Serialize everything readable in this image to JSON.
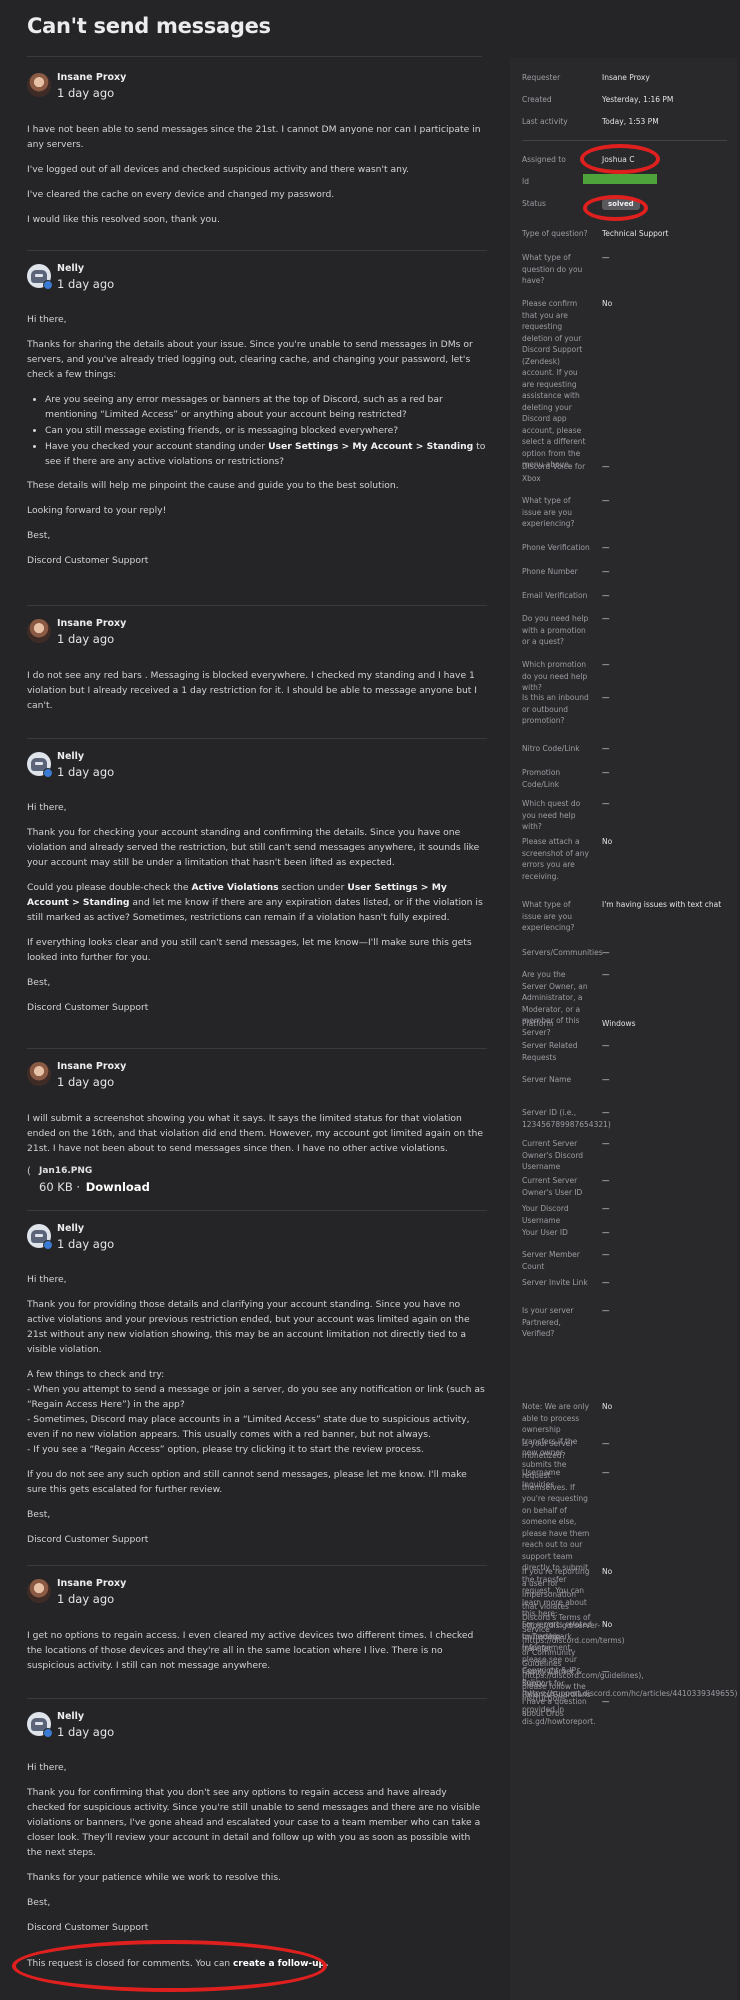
{
  "ticket": {
    "title": "Can't send messages",
    "closed_text": "This request is closed for comments. You can",
    "followup_link": "create a follow-up."
  },
  "messages": [
    {
      "author": "Insane Proxy",
      "time": "1 day ago",
      "paragraphs": [
        "I have not been able to send messages since the 21st. I cannot DM anyone nor can I participate in any servers.",
        "I've logged out of all devices and checked suspicious activity and there wasn't any.",
        "I've cleared the cache on every device and changed my password.",
        "I would like this resolved soon, thank you."
      ]
    },
    {
      "author": "Nelly",
      "time": "1 day ago",
      "p1": "Hi there,",
      "p2": "Thanks for sharing the details about your issue. Since you're unable to send messages in DMs or servers, and you've already tried logging out, clearing cache, and changing your password, let's check a few things:",
      "b1": "Are you seeing any error messages or banners at the top of Discord, such as a red bar mentioning “Limited Access” or anything about your account being restricted?",
      "b2": "Can you still message existing friends, or is messaging blocked everywhere?",
      "b3_pre": "Have you checked your account standing under ",
      "b3_bold": "User Settings > My Account > Standing",
      "b3_post": " to see if there are any active violations or restrictions?",
      "p3": "These details will help me pinpoint the cause and guide you to the best solution.",
      "p4": "Looking forward to your reply!",
      "p5": "Best,",
      "p6": "Discord Customer Support"
    },
    {
      "author": "Insane Proxy",
      "time": "1 day ago",
      "paragraphs": [
        "I do not see any red bars . Messaging is blocked everywhere. I checked my standing and I have 1 violation but I already received a 1 day restriction for it. I should be able to message anyone but I can't."
      ]
    },
    {
      "author": "Nelly",
      "time": "1 day ago",
      "p1": "Hi there,",
      "p2": "Thank you for checking your account standing and confirming the details. Since you have one violation and already served the restriction, but still can't send messages anywhere, it sounds like your account may still be under a limitation that hasn't been lifted as expected.",
      "p3_a": "Could you please double-check the ",
      "p3_b": "Active Violations",
      "p3_c": " section under ",
      "p3_d": "User Settings > My Account > Standing",
      "p3_e": " and let me know if there are any expiration dates listed, or if the violation is still marked as active? Sometimes, restrictions can remain if a violation hasn't fully expired.",
      "p4": "If everything looks clear and you still can't send messages, let me know—I'll make sure this gets looked into further for you.",
      "p5": "Best,",
      "p6": "Discord Customer Support"
    },
    {
      "author": "Insane Proxy",
      "time": "1 day ago",
      "paragraphs": [
        "I will submit a screenshot showing you what it says. It says the limited status for that violation ended on the 16th, and that violation did end them. However, my account got limited again on the 21st. I have not been about to send messages since then. I have no other active violations."
      ],
      "attachment": {
        "name": "Jan16.PNG",
        "size": "60 KB",
        "separator": "·",
        "download": "Download"
      }
    },
    {
      "author": "Nelly",
      "time": "1 day ago",
      "paragraphs": [
        "Hi there,",
        "Thank you for providing those details and clarifying your account standing. Since you have no active violations and your previous restriction ended, but your account was limited again on the 21st without any new violation showing, this may be an account limitation not directly tied to a visible violation.",
        "A few things to check and try:\n- When you attempt to send a message or join a server, do you see any notification or link (such as “Regain Access Here”) in the app?\n- Sometimes, Discord may place accounts in a “Limited Access” state due to suspicious activity, even if no new violation appears. This usually comes with a red banner, but not always.\n- If you see a “Regain Access” option, please try clicking it to start the review process.",
        "If you do not see any such option and still cannot send messages, please let me know. I'll make sure this gets escalated for further review.",
        "Best,",
        "Discord Customer Support"
      ]
    },
    {
      "author": "Insane Proxy",
      "time": "1 day ago",
      "paragraphs": [
        "I get no options to regain access. I even cleared my active devices two different times. I checked the locations of those devices and they're all in the same location where I live. There is no suspicious activity. I still can not message anywhere."
      ]
    },
    {
      "author": "Nelly",
      "time": "1 day ago",
      "paragraphs": [
        "Hi there,",
        "Thank you for confirming that you don't see any options to regain access and have already checked for suspicious activity. Since you're still unable to send messages and there are no visible violations or banners, I've gone ahead and escalated your case to a team member who can take a closer look. They'll review your account in detail and follow up with you as soon as possible with the next steps.",
        "Thanks for your patience while we work to resolve this.",
        "Best,",
        "Discord Customer Support"
      ]
    }
  ],
  "sidebar": {
    "meta": [
      {
        "k": "Requester",
        "v": "Insane Proxy"
      },
      {
        "k": "Created",
        "v": "Yesterday, 1:16 PM"
      },
      {
        "k": "Last activity",
        "v": "Today, 1:53 PM"
      }
    ],
    "fields": [
      {
        "k": "Assigned to",
        "v": "Joshua C"
      },
      {
        "k": "Id",
        "v": ""
      },
      {
        "k": "Status",
        "v": "solved"
      },
      {
        "k": "Type of question?",
        "v": "Technical Support"
      },
      {
        "k": "What type of question do you have?",
        "v": "—"
      },
      {
        "k": "Please confirm that you are requesting deletion of your Discord Support (Zendesk) account. If you are requesting assistance with deleting your Discord app account, please select a different option from the menu above.",
        "v": "No"
      },
      {
        "k": "Discord Voice for Xbox",
        "v": "—"
      },
      {
        "k": "What type of issue are you experiencing?",
        "v": "—"
      },
      {
        "k": "Phone Verification",
        "v": "—"
      },
      {
        "k": "Phone Number",
        "v": "—"
      },
      {
        "k": "Email Verification",
        "v": "—"
      },
      {
        "k": "Do you need help with a promotion or a quest?",
        "v": "—"
      },
      {
        "k": "Which promotion do you need help with?",
        "v": "—"
      },
      {
        "k": "Is this an inbound or outbound promotion?",
        "v": "—"
      },
      {
        "k": "Nitro Code/Link",
        "v": "—"
      },
      {
        "k": "Promotion Code/Link",
        "v": "—"
      },
      {
        "k": "Which quest do you need help with?",
        "v": "—"
      },
      {
        "k": "Please attach a screenshot of any errors you are receiving.",
        "v": "No"
      },
      {
        "k": "What type of issue are you experiencing?",
        "v": "I'm having issues with text chat"
      },
      {
        "k": "Servers/Communities",
        "v": "—"
      },
      {
        "k": "Are you the Server Owner, an Administrator, a Moderator, or a member of this Server?",
        "v": "—"
      },
      {
        "k": "Platform",
        "v": "Windows"
      },
      {
        "k": "Server Related Requests",
        "v": "—"
      },
      {
        "k": "Server Name",
        "v": "—"
      },
      {
        "k": "Server ID (i.e., 123456789987654321)",
        "v": "—"
      },
      {
        "k": "Current Server Owner's Discord Username",
        "v": "—"
      },
      {
        "k": "Current Server Owner's User ID",
        "v": "—"
      },
      {
        "k": "Your Discord Username",
        "v": "—"
      },
      {
        "k": "Your User ID",
        "v": "—"
      },
      {
        "k": "Server Member Count",
        "v": "—"
      },
      {
        "k": "Server Invite Link",
        "v": "—"
      },
      {
        "k": "Is your server Partnered, Verified?",
        "v": "—"
      },
      {
        "k": "Note: We are only able to process ownership transfers if the new owner submits the request themselves. If you're requesting on behalf of someone else, please have them reach out to our support team directly to submit the transfer request. You can learn more about this here: https://dis.gd/server-ownership-transfer",
        "v": "No"
      },
      {
        "k": "Is your server monetized?",
        "v": "—"
      },
      {
        "k": "Username Inquiries",
        "v": "—"
      },
      {
        "k": "If you're reporting a user for impersonation that violates Discord's Terms of Service (https://discord.com/terms) or Community Guidelines (https://discord.com/guidelines), please follow the instructions provided in dis.gd/howtoreport.",
        "v": "No"
      },
      {
        "k": "For reports related to Trademark Infringement, please see our Copyright & IP Policy (https://support.discord.com/hc/articles/4410339349655)",
        "v": "No"
      },
      {
        "k": "Family Center & Support for Parents/Guardians",
        "v": "—"
      },
      {
        "k": "I have a question about Orbs",
        "v": "—"
      }
    ]
  },
  "colors": {
    "background": "#252527",
    "annotation": "#e0201e",
    "redacted": "#4ea33a"
  }
}
